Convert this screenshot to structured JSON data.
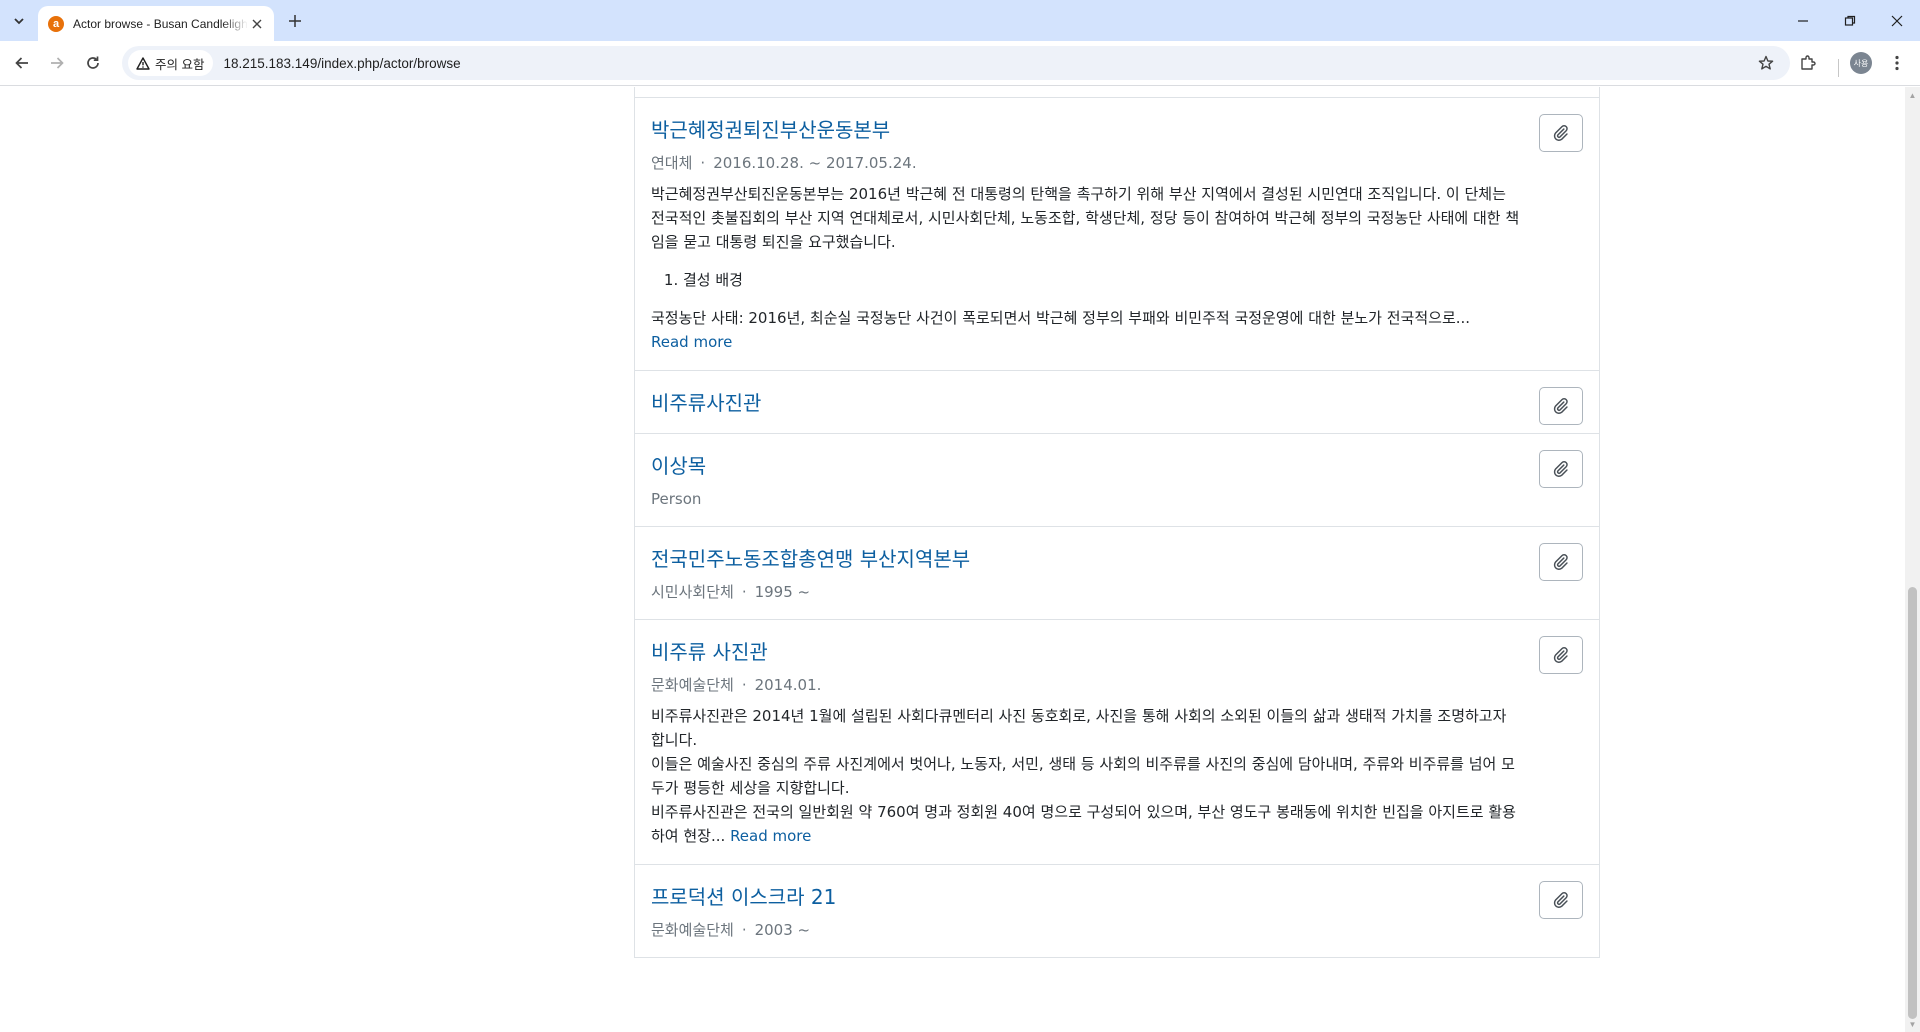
{
  "browser": {
    "tab_title": "Actor browse - Busan Candlelight Archive",
    "favicon_letter": "a",
    "security_label": "주의 요함",
    "url": "18.215.183.149/index.php/actor/browse",
    "profile_initials": "사용"
  },
  "results": [
    {
      "title": "박근혜정권퇴진부산운동본부",
      "type": "연대체",
      "dates": "2016.10.28. ~ 2017.05.24.",
      "desc_paragraph": "박근혜정권부산퇴진운동본부는 2016년 박근혜 전 대통령의 탄핵을 촉구하기 위해 부산 지역에서 결성된 시민연대 조직입니다. 이 단체는 전국적인 촛불집회의 부산 지역 연대체로서, 시민사회단체, 노동조합, 학생단체, 정당 등이 참여하여 박근혜 정부의 국정농단 사태에 대한 책임을 묻고 대통령 퇴진을 요구했습니다.",
      "list_item": "결성 배경",
      "desc_tail": "국정농단 사태: 2016년, 최순실 국정농단 사건이 폭로되면서 박근혜 정부의 부패와 비민주적 국정운영에 대한 분노가 전국적으로...",
      "read_more": "Read more"
    },
    {
      "title": "비주류사진관"
    },
    {
      "title": "이상목",
      "type": "Person"
    },
    {
      "title": "전국민주노동조합총연맹 부산지역본부",
      "type": "시민사회단체",
      "dates": "1995 ~"
    },
    {
      "title": "비주류 사진관",
      "type": "문화예술단체",
      "dates": "2014.01.",
      "desc_line1": "비주류사진관은 2014년 1월에 설립된 사회다큐멘터리 사진 동호회로, 사진을 통해 사회의 소외된 이들의 삶과 생태적 가치를 조명하고자 합니다.",
      "desc_line2": "이들은 예술사진 중심의 주류 사진계에서 벗어나, 노동자, 서민, 생태 등 사회의 비주류를 사진의 중심에 담아내며, 주류와 비주류를 넘어 모두가 평등한 세상을 지향합니다.",
      "desc_line3": "비주류사진관은 전국의 일반회원 약 760여 명과 정회원 40여 명으로 구성되어 있으며, 부산 영도구 봉래동에 위치한 빈집을 아지트로 활용하여 현장...",
      "read_more": "Read more"
    },
    {
      "title": "프로덕션 이스크라 21",
      "type": "문화예술단체",
      "dates": "2003 ~"
    }
  ],
  "meta_separator": "·",
  "icons": {
    "clipboard": "paperclip-icon"
  }
}
